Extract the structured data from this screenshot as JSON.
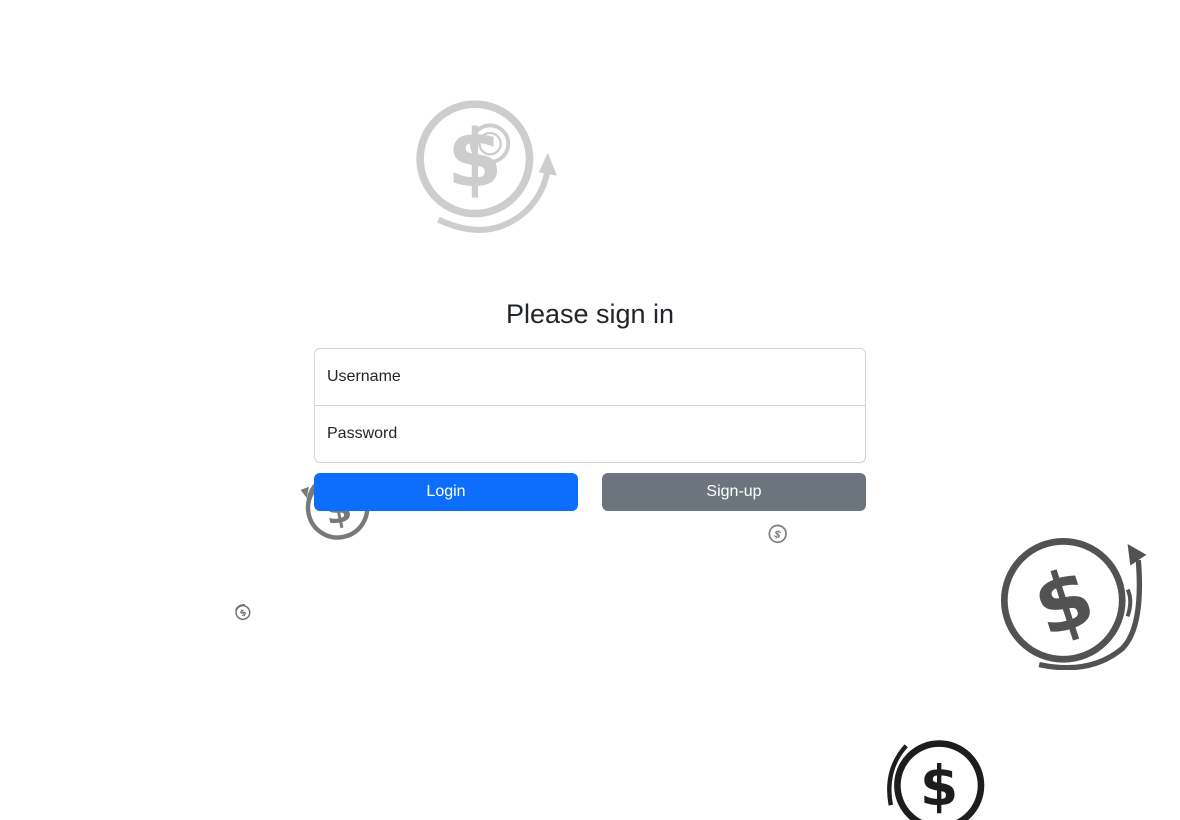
{
  "form": {
    "title": "Please sign in",
    "username_placeholder": "Username",
    "password_placeholder": "Password",
    "login_label": "Login",
    "signup_label": "Sign-up"
  },
  "decorations": {
    "icon": "dollar-coin-arrow-icon",
    "colors": {
      "light": "#b5b5b5",
      "mid": "#666666",
      "dark": "#333333"
    }
  },
  "colors": {
    "primary": "#0d6efd",
    "secondary": "#6c757d",
    "text": "#212529",
    "border": "#ced4da"
  }
}
